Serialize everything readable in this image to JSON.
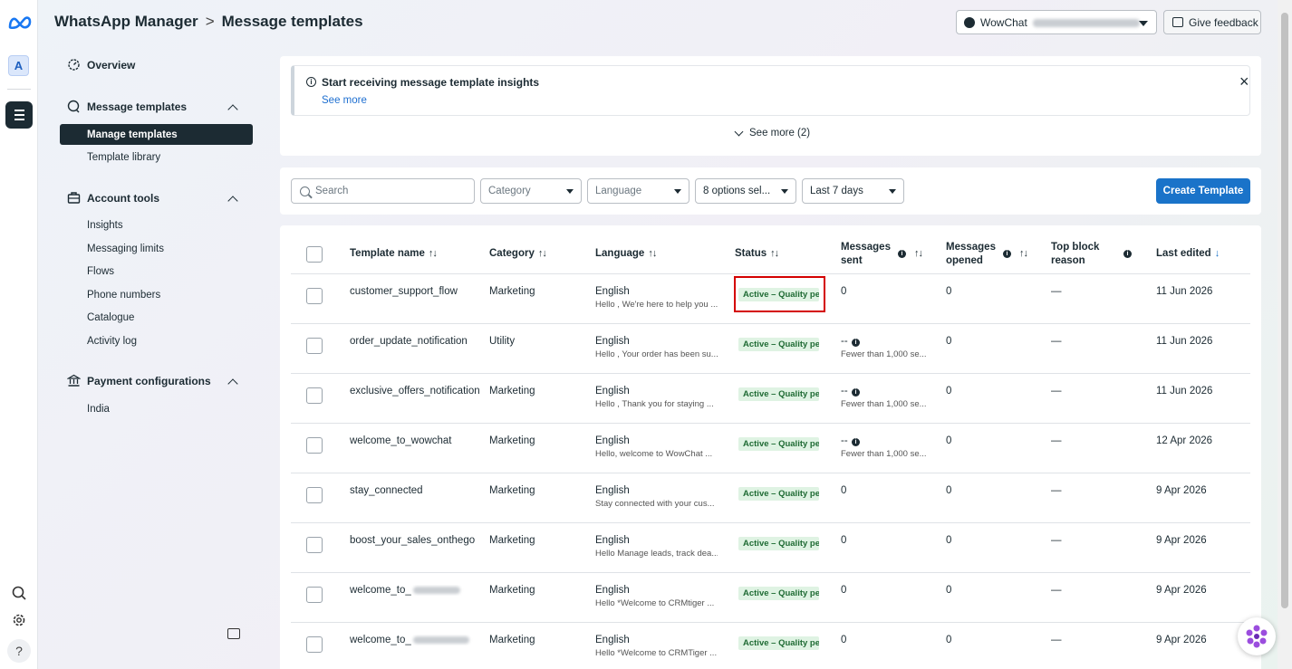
{
  "header": {
    "app_name": "WhatsApp Manager",
    "separator": ">",
    "page_title": "Message templates",
    "account_label": "WowChat",
    "feedback_label": "Give feedback"
  },
  "rail": {
    "account_initial": "A",
    "help_label": "?"
  },
  "sidebar": {
    "overview": "Overview",
    "message_templates": {
      "label": "Message templates",
      "items": [
        "Manage templates",
        "Template library"
      ]
    },
    "account_tools": {
      "label": "Account tools",
      "items": [
        "Insights",
        "Messaging limits",
        "Flows",
        "Phone numbers",
        "Catalogue",
        "Activity log"
      ]
    },
    "payment_configurations": {
      "label": "Payment configurations",
      "items": [
        "India"
      ]
    }
  },
  "banner": {
    "title": "Start receiving message template insights",
    "link": "See more",
    "close": "×",
    "see_more_count": "See more (2)"
  },
  "filters": {
    "search_placeholder": "Search",
    "category": "Category",
    "language": "Language",
    "status": "8 options sel...",
    "date_range": "Last 7 days",
    "create_button": "Create Template"
  },
  "table": {
    "columns": {
      "name": "Template name",
      "category": "Category",
      "language": "Language",
      "status": "Status",
      "sent_1": "Messages",
      "sent_2": "sent",
      "opened_1": "Messages",
      "opened_2": "opened",
      "block_1": "Top block",
      "block_2": "reason",
      "edited": "Last edited"
    },
    "sort_glyph": "↑↓",
    "sort_down_glyph": "↓",
    "info_glyph": "i",
    "rows": [
      {
        "name": "customer_support_flow",
        "category": "Marketing",
        "language": "English",
        "preview": "Hello , We're here to help you ...",
        "status": "Active – Quality pen",
        "sent": "0",
        "sent_note": "",
        "opened": "0",
        "block": "—",
        "edited": "11 Jun 2026"
      },
      {
        "name": "order_update_notification",
        "category": "Utility",
        "language": "English",
        "preview": "Hello , Your order has been su...",
        "status": "Active – Quality pen",
        "sent": "--",
        "sent_note": "Fewer than 1,000 se...",
        "opened": "0",
        "block": "—",
        "edited": "11 Jun 2026"
      },
      {
        "name": "exclusive_offers_notification",
        "category": "Marketing",
        "language": "English",
        "preview": "Hello , Thank you for staying ...",
        "status": "Active – Quality pen",
        "sent": "--",
        "sent_note": "Fewer than 1,000 se...",
        "opened": "0",
        "block": "—",
        "edited": "11 Jun 2026"
      },
      {
        "name": "welcome_to_wowchat",
        "category": "Marketing",
        "language": "English",
        "preview": "Hello, welcome to WowChat ...",
        "status": "Active – Quality pen",
        "sent": "--",
        "sent_note": "Fewer than 1,000 se...",
        "opened": "0",
        "block": "—",
        "edited": "12 Apr 2026"
      },
      {
        "name": "stay_connected",
        "category": "Marketing",
        "language": "English",
        "preview": "Stay connected with your cus...",
        "status": "Active – Quality pen",
        "sent": "0",
        "sent_note": "",
        "opened": "0",
        "block": "—",
        "edited": "9 Apr 2026"
      },
      {
        "name": "boost_your_sales_onthego",
        "category": "Marketing",
        "language": "English",
        "preview": "Hello Manage leads, track dea...",
        "status": "Active – Quality pen",
        "sent": "0",
        "sent_note": "",
        "opened": "0",
        "block": "—",
        "edited": "9 Apr 2026"
      },
      {
        "name": "welcome_to_",
        "category": "Marketing",
        "language": "English",
        "preview": "Hello *Welcome to CRMtiger ...",
        "status": "Active – Quality pen",
        "sent": "0",
        "sent_note": "",
        "opened": "0",
        "block": "—",
        "edited": "9 Apr 2026"
      },
      {
        "name": "welcome_to_",
        "category": "Marketing",
        "language": "English",
        "preview": "Hello *Welcome to CRMTiger ...",
        "status": "Active – Quality pen",
        "sent": "0",
        "sent_note": "",
        "opened": "0",
        "block": "—",
        "edited": "9 Apr 2026"
      }
    ]
  }
}
